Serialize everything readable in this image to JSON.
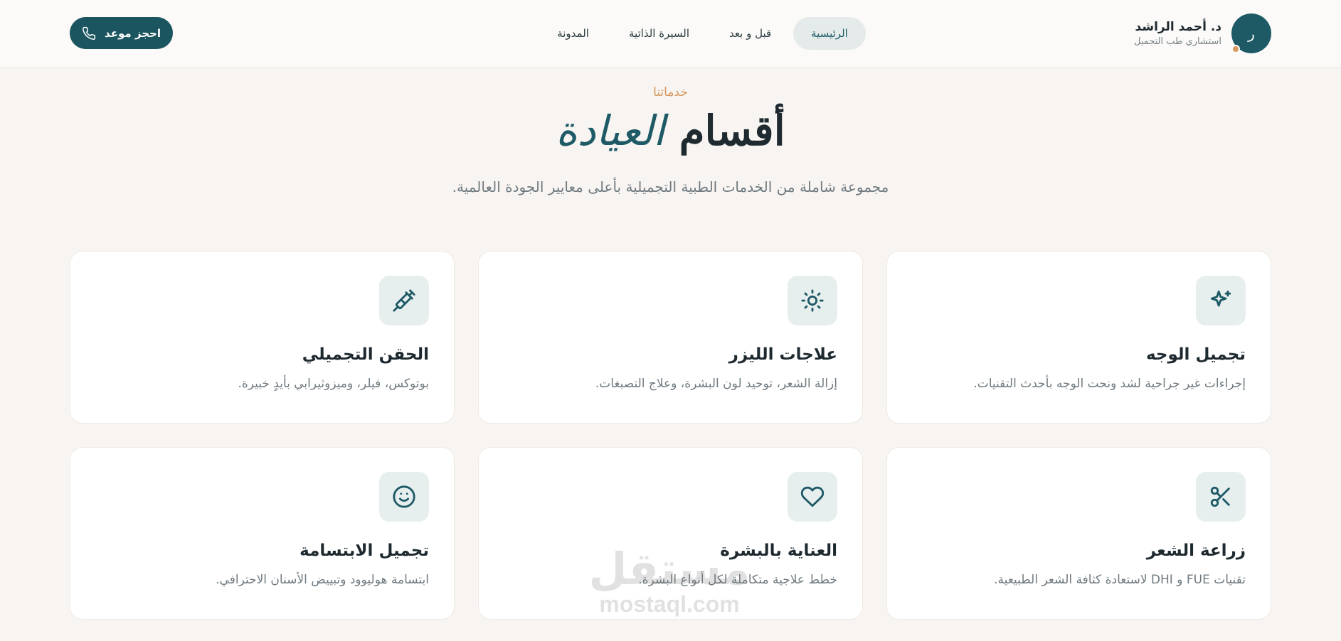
{
  "header": {
    "brand_name": "د. أحمد الراشد",
    "brand_subtitle": "استشاري طب التجميل",
    "avatar_initial": "ر",
    "nav": [
      {
        "label": "الرئيسية",
        "active": true
      },
      {
        "label": "قبل و بعد",
        "active": false
      },
      {
        "label": "السيرة الذاتية",
        "active": false
      },
      {
        "label": "المدونة",
        "active": false
      }
    ],
    "book_button_label": "احجز موعد",
    "book_button_icon": "phone-icon"
  },
  "section": {
    "eyebrow": "خدماتنا",
    "title_main": "أقسام",
    "title_accent": "العيادة",
    "description": "مجموعة شاملة من الخدمات الطبية التجميلية بأعلى معايير الجودة العالمية."
  },
  "cards": [
    {
      "title": "تجميل الوجه",
      "description": "إجراءات غير جراحية لشد ونحت الوجه بأحدث التقنيات.",
      "icon": "sparkles-icon"
    },
    {
      "title": "علاجات الليزر",
      "description": "إزالة الشعر، توحيد لون البشرة، وعلاج التصبغات.",
      "icon": "sun-icon"
    },
    {
      "title": "الحقن التجميلي",
      "description": "بوتوكس، فيلر، وميزوثيرابي بأيدٍ خبيرة.",
      "icon": "syringe-icon"
    },
    {
      "title": "زراعة الشعر",
      "description": "تقنيات FUE و DHI لاستعادة كثافة الشعر الطبيعية.",
      "icon": "scissors-icon"
    },
    {
      "title": "العناية بالبشرة",
      "description": "خطط علاجية متكاملة لكل أنواع البشرة.",
      "icon": "heart-icon"
    },
    {
      "title": "تجميل الابتسامة",
      "description": "ابتسامة هوليوود وتبييض الأسنان الاحترافي.",
      "icon": "smile-icon"
    }
  ],
  "watermark": {
    "arabic": "مستقل",
    "latin": "mostaql.com"
  },
  "colors": {
    "primary": "#1d5a66",
    "accent": "#d6955b",
    "background": "#f7f4f1"
  }
}
